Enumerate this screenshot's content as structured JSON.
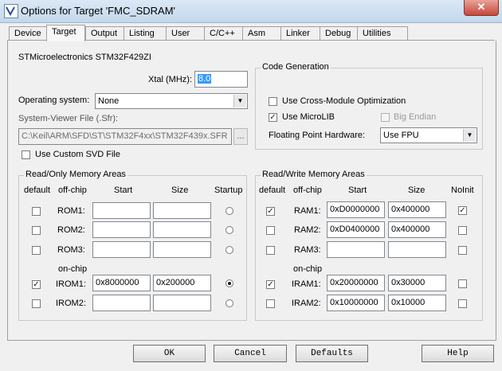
{
  "window": {
    "title": "Options for Target 'FMC_SDRAM'",
    "close_glyph": "✕"
  },
  "tabs": [
    "Device",
    "Target",
    "Output",
    "Listing",
    "User",
    "C/C++",
    "Asm",
    "Linker",
    "Debug",
    "Utilities"
  ],
  "active_tab": "Target",
  "device": {
    "name": "STMicroelectronics STM32F429ZI"
  },
  "xtal": {
    "label": "Xtal (MHz):",
    "value": "8.0"
  },
  "os": {
    "label": "Operating system:",
    "value": "None"
  },
  "svd": {
    "label": "System-Viewer File (.Sfr):",
    "value": "C:\\Keil\\ARM\\SFD\\ST\\STM32F4xx\\STM32F439x.SFR",
    "browse": "...",
    "custom_label": "Use Custom SVD File",
    "custom_checked": false
  },
  "codegen": {
    "title": "Code Generation",
    "cross_module": {
      "label": "Use Cross-Module Optimization",
      "checked": false
    },
    "microlib": {
      "label": "Use MicroLIB",
      "checked": true
    },
    "big_endian": {
      "label": "Big Endian",
      "checked": false
    },
    "fpu_label": "Floating Point Hardware:",
    "fpu_value": "Use FPU"
  },
  "rom": {
    "title": "Read/Only Memory Areas",
    "headers": {
      "default": "default",
      "offchip": "off-chip",
      "start": "Start",
      "size": "Size",
      "startup": "Startup"
    },
    "onchip_label": "on-chip",
    "rows": [
      {
        "name": "ROM1:",
        "default": false,
        "start": "",
        "size": "",
        "startup": false
      },
      {
        "name": "ROM2:",
        "default": false,
        "start": "",
        "size": "",
        "startup": false
      },
      {
        "name": "ROM3:",
        "default": false,
        "start": "",
        "size": "",
        "startup": false
      },
      {
        "name": "IROM1:",
        "default": true,
        "start": "0x8000000",
        "size": "0x200000",
        "startup": true
      },
      {
        "name": "IROM2:",
        "default": false,
        "start": "",
        "size": "",
        "startup": false
      }
    ]
  },
  "ram": {
    "title": "Read/Write Memory Areas",
    "headers": {
      "default": "default",
      "offchip": "off-chip",
      "start": "Start",
      "size": "Size",
      "noinit": "NoInit"
    },
    "onchip_label": "on-chip",
    "rows": [
      {
        "name": "RAM1:",
        "default": true,
        "start": "0xD0000000",
        "size": "0x400000",
        "noinit": true
      },
      {
        "name": "RAM2:",
        "default": false,
        "start": "0xD0400000",
        "size": "0x400000",
        "noinit": false
      },
      {
        "name": "RAM3:",
        "default": false,
        "start": "",
        "size": "",
        "noinit": false
      },
      {
        "name": "IRAM1:",
        "default": true,
        "start": "0x20000000",
        "size": "0x30000",
        "noinit": false
      },
      {
        "name": "IRAM2:",
        "default": false,
        "start": "0x10000000",
        "size": "0x10000",
        "noinit": false
      }
    ]
  },
  "buttons": {
    "ok": "OK",
    "cancel": "Cancel",
    "defaults": "Defaults",
    "help": "Help"
  },
  "glyphs": {
    "check": "✓",
    "dropdown": "▼"
  }
}
